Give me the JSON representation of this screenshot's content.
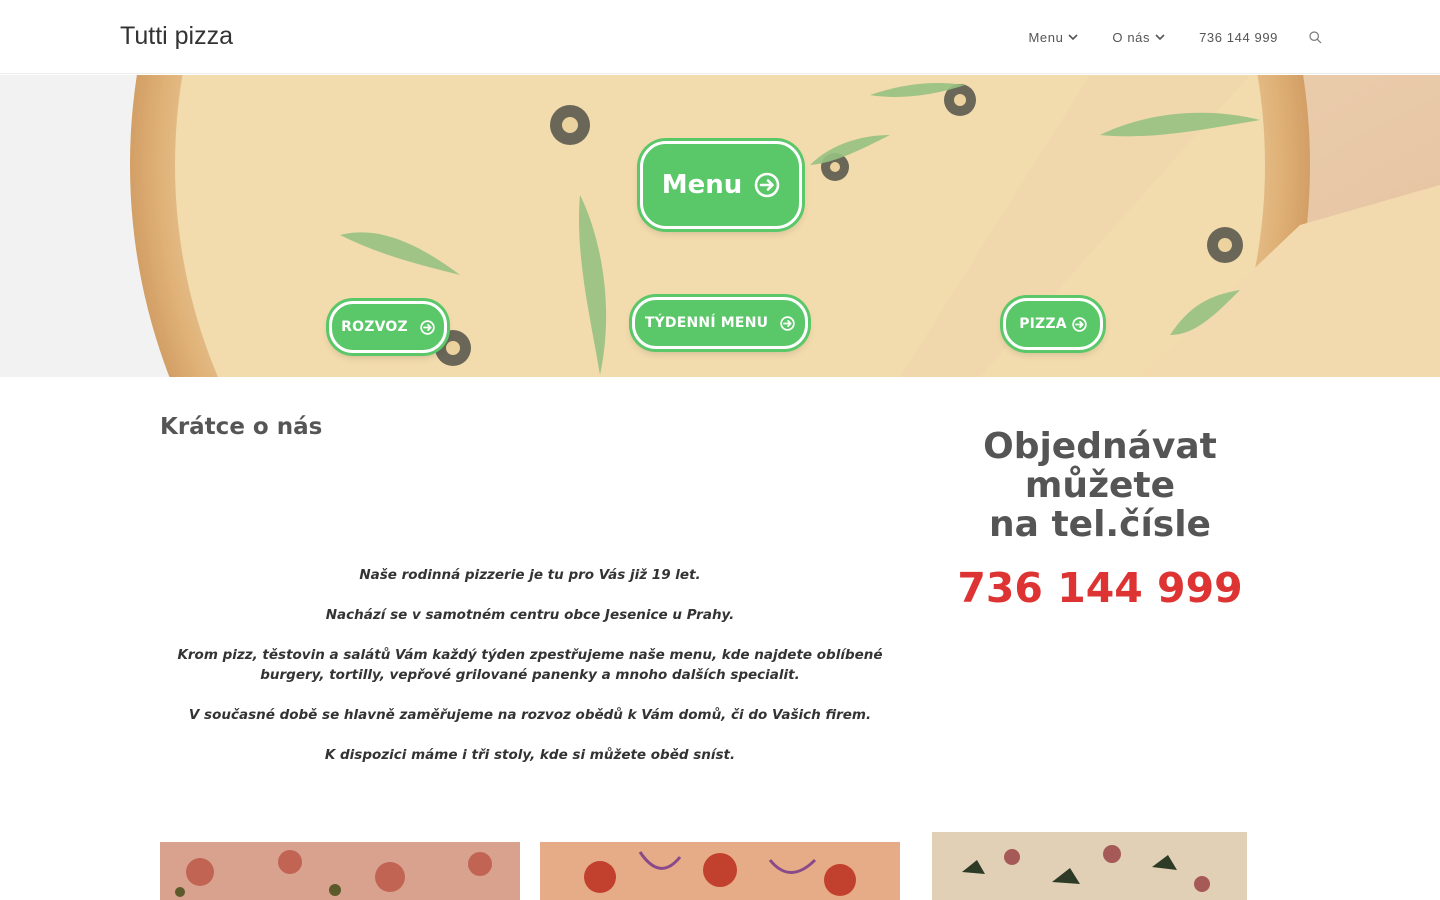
{
  "site": {
    "logo": "Tutti pizza"
  },
  "nav": {
    "items": [
      {
        "label": "Menu",
        "has_dropdown": true
      },
      {
        "label": "O nás",
        "has_dropdown": true
      },
      {
        "label": "736 144 999",
        "has_dropdown": false
      }
    ],
    "search_icon": "search-icon"
  },
  "hero": {
    "main_button": "Menu",
    "buttons": {
      "rozvoz": "ROZVOZ",
      "tydenni": "TÝDENNÍ MENU",
      "pizza": "PIZZA"
    },
    "button_color": "#5ac768",
    "button_icon": "arrow-circle-right-icon"
  },
  "about": {
    "title": "Krátce o nás",
    "paragraphs": [
      "Naše rodinná pizzerie je tu pro Vás již 19 let.",
      "Nachází se v samotném centru obce Jesenice u Prahy.",
      "Krom pizz, těstovin a salátů Vám každý týden zpestřujeme naše menu, kde najdete oblíbené burgery, tortilly, vepřové grilované panenky a mnoho dalších specialit.",
      "V současné době se hlavně zaměřujeme na rozvoz obědů k Vám domů, či do Vašich firem.",
      "K dispozici máme i tři stoly, kde si můžete  oběd sníst."
    ]
  },
  "order": {
    "title_line1": "Objednávat můžete",
    "title_line2": "na tel.čísle",
    "phone": "736 144 999",
    "phone_color": "#dd3333"
  }
}
